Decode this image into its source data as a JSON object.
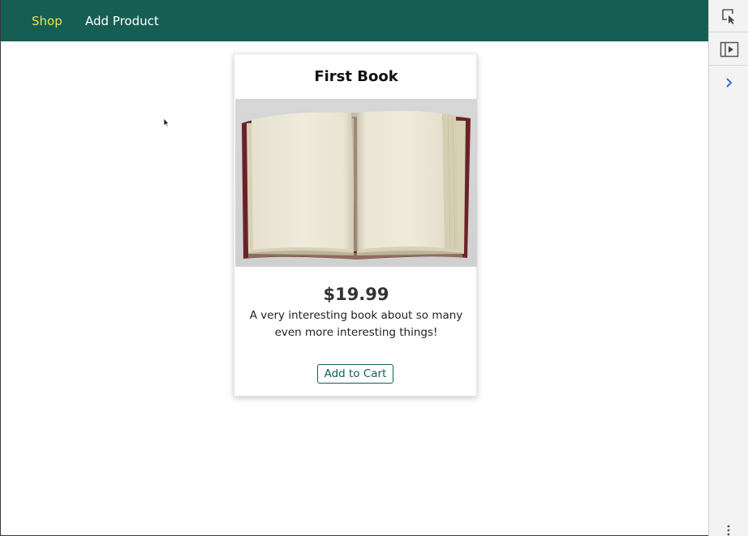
{
  "nav": {
    "items": [
      {
        "label": "Shop",
        "active": true
      },
      {
        "label": "Add Product",
        "active": false
      }
    ]
  },
  "product": {
    "title": "First Book",
    "price": "$19.99",
    "description": "A very interesting book about so many even more interesting things!",
    "add_to_cart_label": "Add to Cart",
    "image_alt": "open-book-image"
  },
  "devtools": {
    "icons": [
      "inspect-element-icon",
      "toggle-panel-icon",
      "chevron-right-icon",
      "more-options-icon"
    ]
  },
  "colors": {
    "header_bg": "#165e54",
    "nav_active": "#f0e34a",
    "nav_text": "#ffffff",
    "button_accent": "#165e54"
  }
}
